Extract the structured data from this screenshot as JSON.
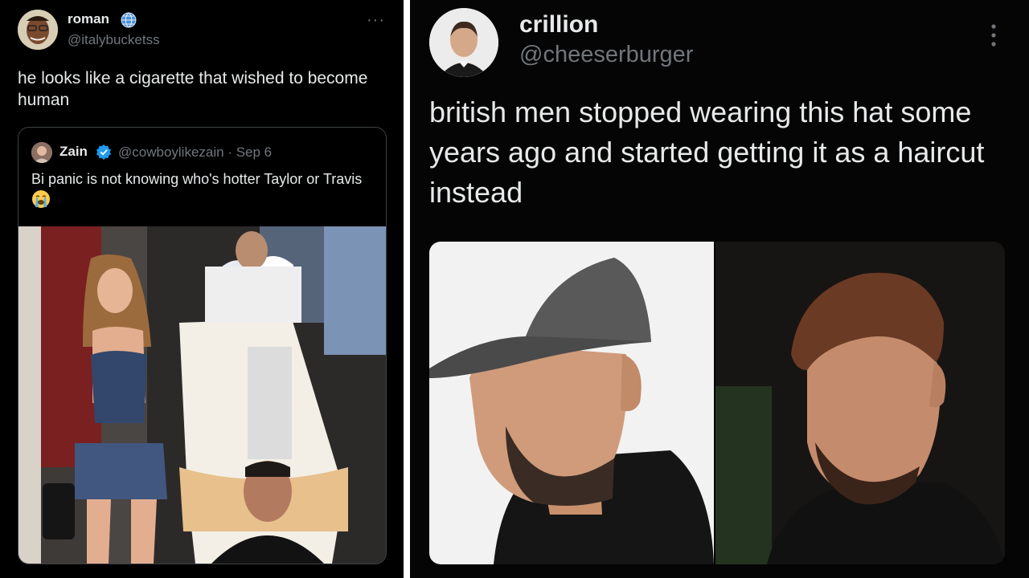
{
  "left_tweet": {
    "display_name": "roman",
    "handle": "@italybucketss",
    "more": "···",
    "text": "he looks like a cigarette that wished to become human",
    "quoted": {
      "display_name": "Zain",
      "handle_date": "@cowboylikezain · Sep 6",
      "text": "Bi panic is not knowing who's hotter Taylor or Travis"
    }
  },
  "right_tweet": {
    "display_name": "crillion",
    "handle": "@cheeserburger",
    "text": "british men stopped wearing this hat some years ago and started getting it as a haircut instead"
  },
  "icons": {
    "globe": "globe-icon",
    "verified": "verified-badge-icon",
    "emoji": "loudly-crying-face-emoji",
    "more": "more-options-icon"
  },
  "colors": {
    "background": "#000000",
    "text_primary": "#e7e9ea",
    "text_secondary": "#71767b",
    "verified_blue": "#1d9bf0"
  }
}
